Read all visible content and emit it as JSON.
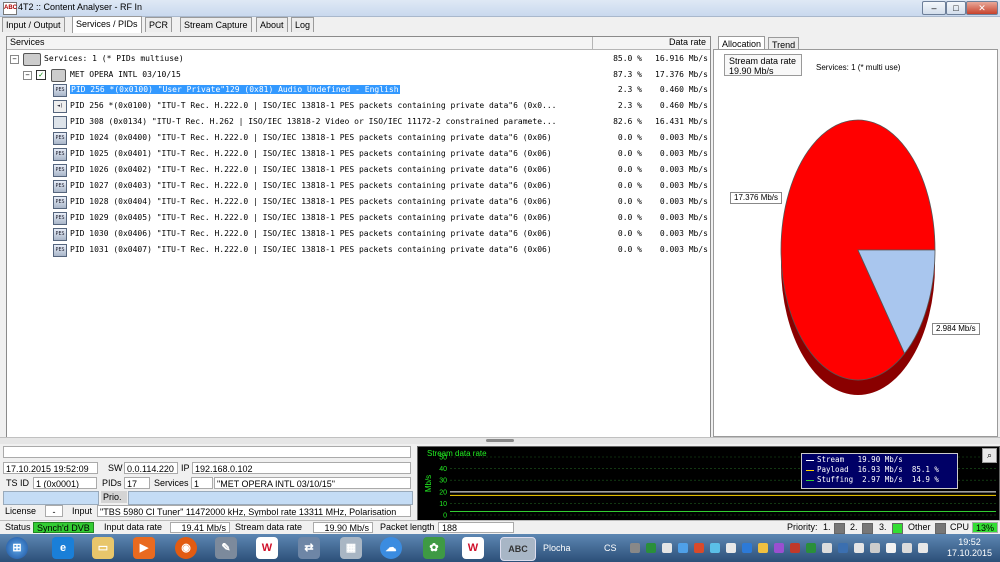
{
  "window": {
    "icon_text": "ABC",
    "title": "4T2 :: Content Analyser - RF In"
  },
  "main_tabs": [
    "Input / Output",
    "Services / PIDs",
    "PCR",
    "Stream Capture",
    "About",
    "Log"
  ],
  "services": {
    "header_services": "Services",
    "header_rate": "Data rate",
    "rows": [
      {
        "text": "Services: 1 (* PIDs multiuse)",
        "pct": "85.0 %",
        "rate": "16.916 Mb/s"
      },
      {
        "text": "MET OPERA INTL 03/10/15",
        "pct": "87.3 %",
        "rate": "17.376 Mb/s"
      },
      {
        "text": "PID 256 *(0x0100) \"User Private\"129 (0x81) Audio Undefined - English",
        "pct": "2.3 %",
        "rate": "0.460 Mb/s",
        "icon": "PES"
      },
      {
        "text": "PID 256 *(0x0100) \"ITU-T Rec. H.222.0 | ISO/IEC 13818-1 PES packets containing private data\"6 (0x0...",
        "pct": "2.3 %",
        "rate": "0.460 Mb/s"
      },
      {
        "text": "PID 308 (0x0134) \"ITU-T Rec. H.262 | ISO/IEC 13818-2 Video or ISO/IEC 11172-2 constrained paramete...",
        "pct": "82.6 %",
        "rate": "16.431 Mb/s"
      },
      {
        "text": "PID 1024 (0x0400) \"ITU-T Rec. H.222.0 | ISO/IEC 13818-1 PES packets containing private data\"6 (0x06)",
        "pct": "0.0 %",
        "rate": "0.003 Mb/s",
        "icon": "PES"
      },
      {
        "text": "PID 1025 (0x0401) \"ITU-T Rec. H.222.0 | ISO/IEC 13818-1 PES packets containing private data\"6 (0x06)",
        "pct": "0.0 %",
        "rate": "0.003 Mb/s",
        "icon": "PES"
      },
      {
        "text": "PID 1026 (0x0402) \"ITU-T Rec. H.222.0 | ISO/IEC 13818-1 PES packets containing private data\"6 (0x06)",
        "pct": "0.0 %",
        "rate": "0.003 Mb/s",
        "icon": "PES"
      },
      {
        "text": "PID 1027 (0x0403) \"ITU-T Rec. H.222.0 | ISO/IEC 13818-1 PES packets containing private data\"6 (0x06)",
        "pct": "0.0 %",
        "rate": "0.003 Mb/s",
        "icon": "PES"
      },
      {
        "text": "PID 1028 (0x0404) \"ITU-T Rec. H.222.0 | ISO/IEC 13818-1 PES packets containing private data\"6 (0x06)",
        "pct": "0.0 %",
        "rate": "0.003 Mb/s",
        "icon": "PES"
      },
      {
        "text": "PID 1029 (0x0405) \"ITU-T Rec. H.222.0 | ISO/IEC 13818-1 PES packets containing private data\"6 (0x06)",
        "pct": "0.0 %",
        "rate": "0.003 Mb/s",
        "icon": "PES"
      },
      {
        "text": "PID 1030 (0x0406) \"ITU-T Rec. H.222.0 | ISO/IEC 13818-1 PES packets containing private data\"6 (0x06)",
        "pct": "0.0 %",
        "rate": "0.003 Mb/s",
        "icon": "PES"
      },
      {
        "text": "PID 1031 (0x0407) \"ITU-T Rec. H.222.0 | ISO/IEC 13818-1 PES packets containing private data\"6 (0x06)",
        "pct": "0.0 %",
        "rate": "0.003 Mb/s",
        "icon": "PES"
      }
    ]
  },
  "right_tabs": [
    "Allocation",
    "Trend"
  ],
  "allocation": {
    "stream_label": "Stream data rate",
    "stream_value": "19.90 Mb/s",
    "services_note": "Services: 1 (* multi use)",
    "label_main": "17.376 Mb/s",
    "label_other": "2.984 Mb/s",
    "colors": {
      "main": "#ff0000",
      "other": "#a9c6ee"
    }
  },
  "chart_data": [
    {
      "type": "pie",
      "title": "",
      "labels": [
        "17.376 Mb/s",
        "2.984 Mb/s"
      ],
      "values": [
        17.376,
        2.984
      ]
    },
    {
      "type": "line",
      "title": "Stream data rate",
      "ylabel": "Mb/s",
      "ylim": [
        0,
        50
      ],
      "yticks": [
        0,
        10,
        20,
        30,
        40,
        50
      ],
      "series": [
        {
          "name": "Stream",
          "value": 19.9,
          "color": "#ffffff"
        },
        {
          "name": "Payload",
          "value": 16.93,
          "color": "#ffd400"
        },
        {
          "name": "Stuffing",
          "value": 2.97,
          "color": "#33cc33"
        }
      ]
    }
  ],
  "info": {
    "datetime": "17.10.2015 19:52:09",
    "sw_label": "SW",
    "sw_value": "0.0.114.220",
    "ip_label": "IP",
    "ip_value": "192.168.0.102",
    "tsid_label": "TS ID",
    "tsid_value": "1 (0x0001)",
    "pids_label": "PIDs",
    "pids_value": "17",
    "services_label": "Services",
    "services_value": "1",
    "service_name": "\"MET OPERA INTL 03/10/15\"",
    "prio_label": "Prio.",
    "license_label": "License",
    "license_value": "-",
    "input_label": "Input",
    "input_value": "\"TBS 5980 CI Tuner\" 11472000 kHz, Symbol rate 13311 MHz, Polarisation"
  },
  "graph": {
    "legend_stream": "Stream   19.90 Mb/s",
    "legend_payload": "Payload  16.93 Mb/s  85.1 %",
    "legend_stuffing": "Stuffing  2.97 Mb/s  14.9 %"
  },
  "status": {
    "status_label": "Status",
    "status_value": "Synch'd DVB",
    "input_rate_label": "Input data rate",
    "input_rate_value": "19.41",
    "input_rate_unit": "Mb/s",
    "stream_rate_label": "Stream data rate",
    "stream_rate_value": "19.90",
    "stream_rate_unit": "Mb/s",
    "packet_label": "Packet length",
    "packet_value": "188",
    "priority_label": "Priority:",
    "p1": "1.",
    "p2": "2.",
    "p3": "3.",
    "other_label": "Other",
    "cpu_label": "CPU",
    "cpu_value": "13%"
  },
  "taskbar": {
    "plocha": "Plocha",
    "lang": "CS",
    "time": "19:52",
    "date": "17.10.2015",
    "active_app": "ABC"
  }
}
